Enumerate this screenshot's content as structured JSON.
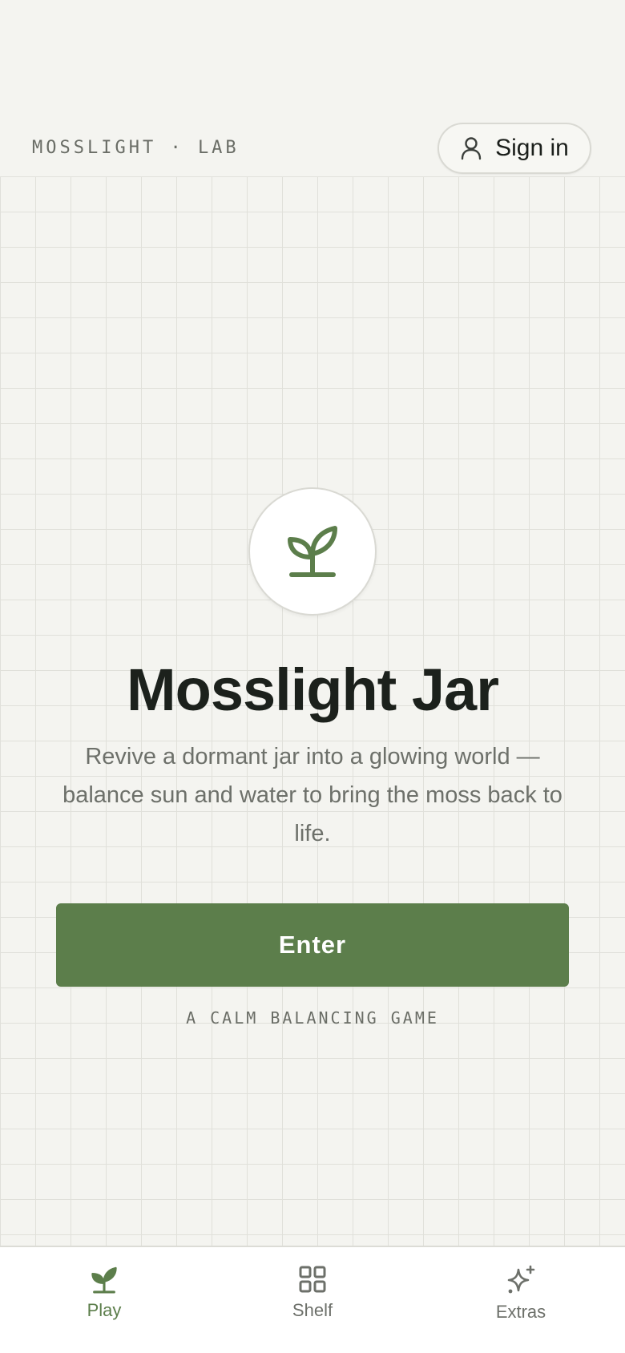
{
  "header": {
    "brand": "MOSSLIGHT · LAB",
    "signin_label": "Sign in",
    "signin_icon": "user-icon"
  },
  "hero": {
    "icon": "sprout-icon",
    "title": "Mosslight Jar",
    "subtitle": "Revive a dormant jar into a glowing world — balance sun and water to bring the moss back to life.",
    "enter_label": "Enter",
    "tagline": "A CALM BALANCING GAME"
  },
  "nav": {
    "items": [
      {
        "label": "Play",
        "icon": "sprout-icon",
        "active": true
      },
      {
        "label": "Shelf",
        "icon": "grid-icon",
        "active": false
      },
      {
        "label": "Extras",
        "icon": "sparkle-icon",
        "active": false
      }
    ]
  },
  "colors": {
    "background": "#f4f4f0",
    "accent": "#5c7e4b",
    "text": "#1c211c",
    "muted": "#6d706a"
  }
}
